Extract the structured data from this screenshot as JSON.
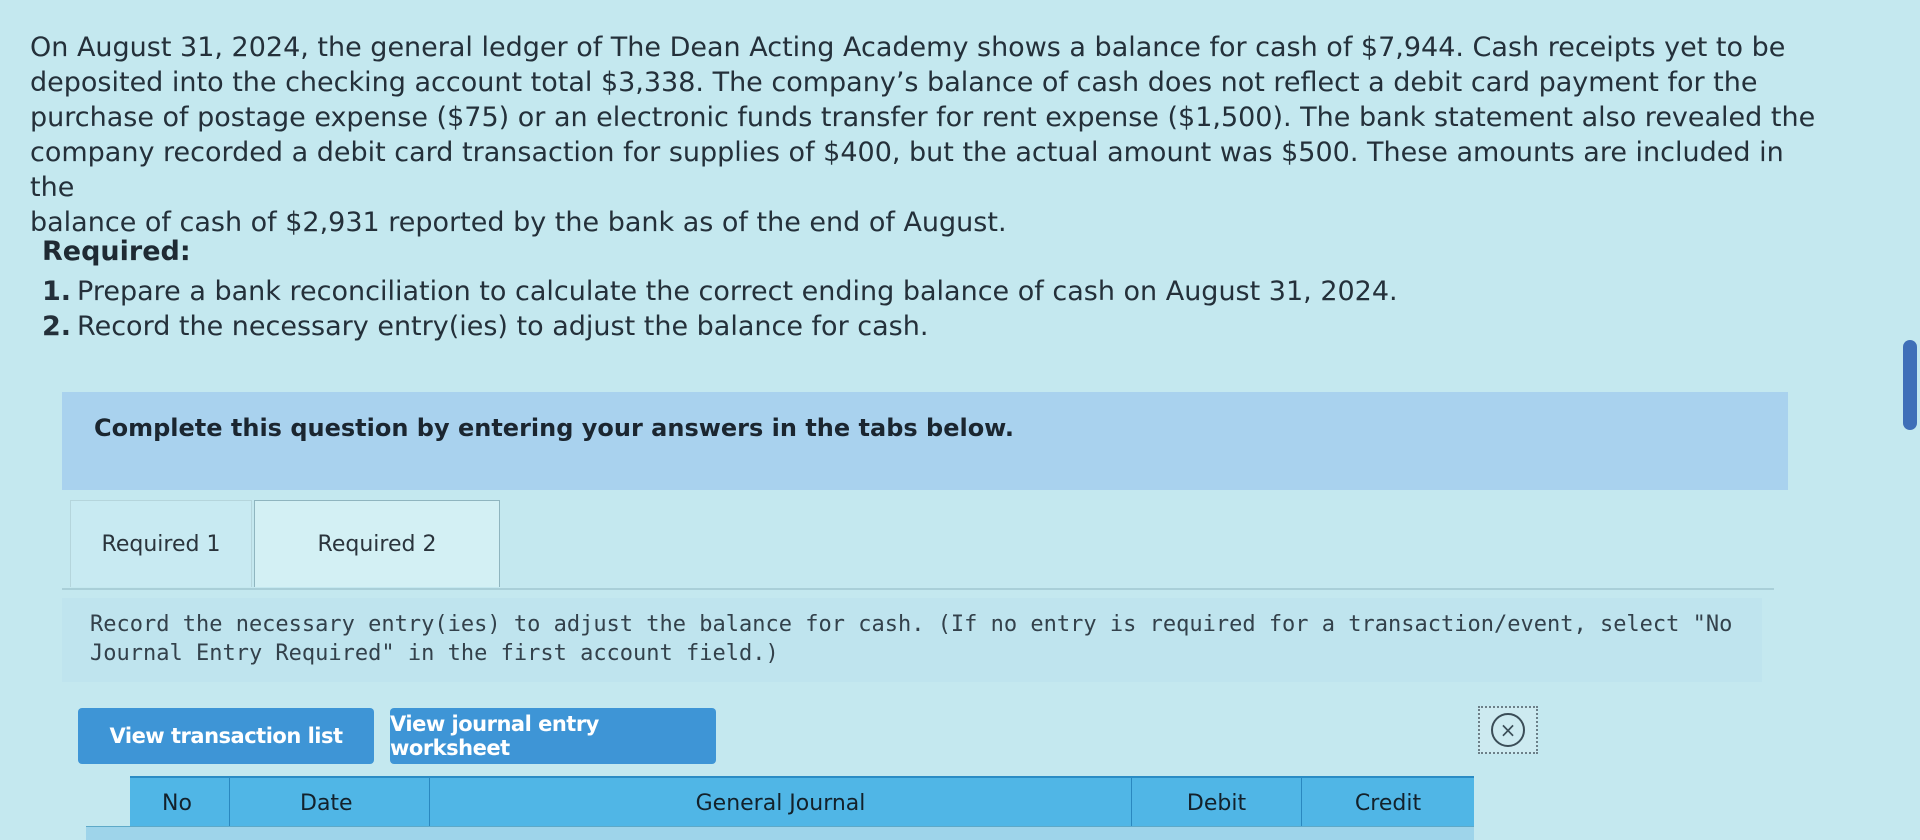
{
  "problem": {
    "lines": [
      "On August 31, 2024, the general ledger of The Dean Acting Academy shows a balance for cash of $7,944. Cash receipts yet to be",
      "deposited into the checking account total $3,338. The company’s balance of cash does not reflect a debit card payment for the",
      "purchase of postage expense ($75) or an electronic funds transfer for rent expense ($1,500). The bank statement also revealed the",
      "company recorded a debit card transaction for supplies of $400, but the actual amount was $500. These amounts are included in the",
      "balance of cash of $2,931 reported by the bank as of the end of August."
    ]
  },
  "required": {
    "heading": "Required:",
    "items": [
      {
        "num": "1.",
        "text": "Prepare a bank reconciliation to calculate the correct ending balance of cash on August 31, 2024."
      },
      {
        "num": "2.",
        "text": "Record the necessary entry(ies) to adjust the balance for cash."
      }
    ]
  },
  "banner": {
    "text": "Complete this question by entering your answers in the tabs below."
  },
  "tabs": [
    {
      "label": "Required 1",
      "active": false
    },
    {
      "label": "Required 2",
      "active": true
    }
  ],
  "instruction": {
    "text": "Record the necessary entry(ies) to adjust the balance for cash. (If no entry is required for a transaction/event, select \"No Journal Entry Required\" in the first account field.)"
  },
  "buttons": {
    "view_transaction_list": "View transaction list",
    "view_journal_worksheet": "View journal entry worksheet"
  },
  "table": {
    "headers": [
      "No",
      "Date",
      "General Journal",
      "Debit",
      "Credit"
    ]
  },
  "colors": {
    "accent_button": "#3e95d6",
    "table_header": "#50b6e6",
    "banner": "#a9d2ee"
  }
}
